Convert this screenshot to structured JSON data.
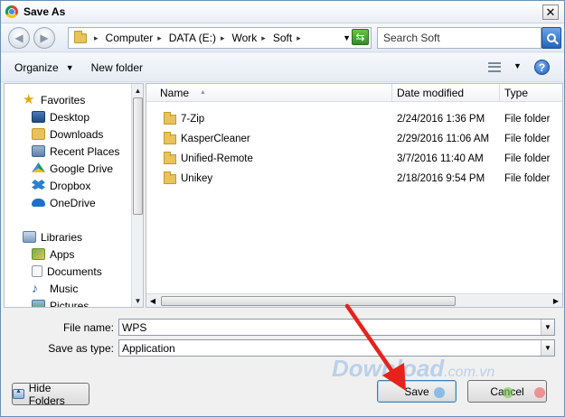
{
  "window": {
    "title": "Save As"
  },
  "address": {
    "crumbs": [
      "Computer",
      "DATA (E:)",
      "Work",
      "Soft"
    ],
    "search_placeholder": "Search Soft"
  },
  "toolbar": {
    "organize": "Organize",
    "new_folder": "New folder"
  },
  "nav": {
    "favorites": {
      "label": "Favorites",
      "items": [
        "Desktop",
        "Downloads",
        "Recent Places",
        "Google Drive",
        "Dropbox",
        "OneDrive"
      ]
    },
    "libraries": {
      "label": "Libraries",
      "items": [
        "Apps",
        "Documents",
        "Music",
        "Pictures"
      ]
    }
  },
  "columns": {
    "name": "Name",
    "date": "Date modified",
    "type": "Type"
  },
  "files": [
    {
      "name": "7-Zip",
      "date": "2/24/2016 1:36 PM",
      "type": "File folder"
    },
    {
      "name": "KasperCleaner",
      "date": "2/29/2016 11:06 AM",
      "type": "File folder"
    },
    {
      "name": "Unified-Remote",
      "date": "3/7/2016 11:40 AM",
      "type": "File folder"
    },
    {
      "name": "Unikey",
      "date": "2/18/2016 9:54 PM",
      "type": "File folder"
    }
  ],
  "form": {
    "file_name_label": "File name:",
    "file_name_value": "WPS",
    "save_type_label": "Save as type:",
    "save_type_value": "Application"
  },
  "buttons": {
    "hide_folders": "Hide Folders",
    "save": "Save",
    "cancel": "Cancel"
  },
  "watermark": {
    "main": "Download",
    "suffix": ".com.vn"
  },
  "colors": {
    "accent": "#3c7fb1",
    "arrow": "#e8221b",
    "folder": "#e8c25a"
  }
}
